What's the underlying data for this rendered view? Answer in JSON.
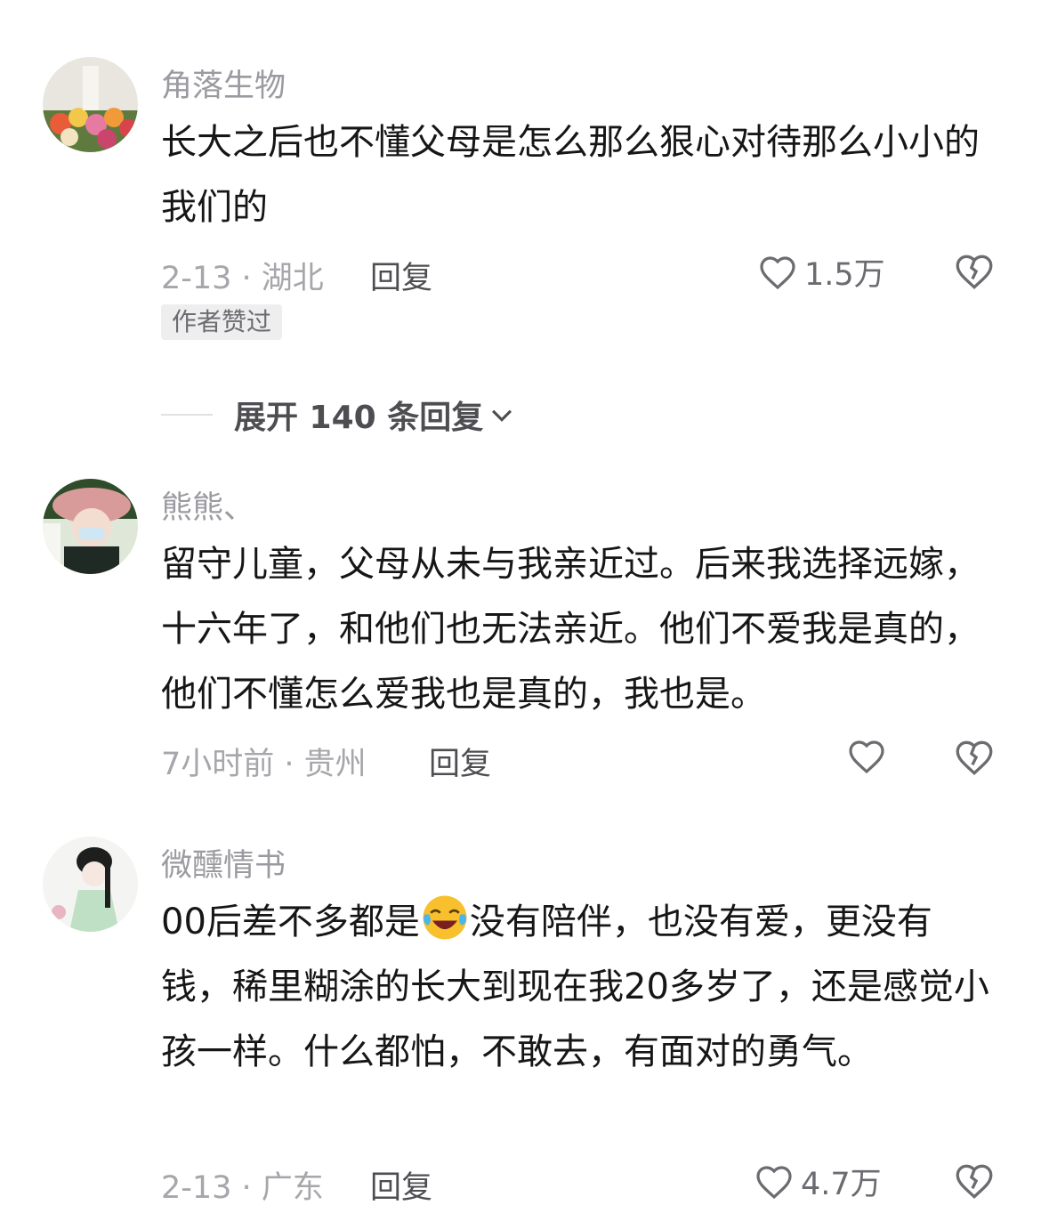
{
  "comments": [
    {
      "username": "角落生物",
      "text": "长大之后也不懂父母是怎么那么狠心对待那么小小的我们的",
      "meta": "2-13 · 湖北",
      "reply_label": "回复",
      "likes": "1.5万",
      "badge": "作者赞过"
    },
    {
      "username": "熊熊、",
      "text": "留守儿童，父母从未与我亲近过。后来我选择远嫁，十六年了，和他们也无法亲近。他们不爱我是真的，他们不懂怎么爱我也是真的，我也是。",
      "meta": "7小时前 · 贵州",
      "reply_label": "回复",
      "likes": ""
    },
    {
      "username": "微醺情书",
      "text_before_emoji": "00后差不多都是",
      "text_after_emoji": "没有陪伴，也没有爱，更没有钱，稀里糊涂的长大到现在我20多岁了，还是感觉小孩一样。什么都怕，不敢去，有面对的勇气。",
      "meta": "2-13 · 广东",
      "reply_label": "回复",
      "likes": "4.7万"
    }
  ],
  "expand_label": "展开 140 条回复",
  "icons": {
    "like": "heart-outline-icon",
    "dislike": "broken-heart-icon",
    "expand": "chevron-down-icon",
    "emoji": "laughing-crying-emoji"
  },
  "colors": {
    "text": "#161616",
    "muted": "#9a9aa0",
    "reply": "#4e4e52"
  }
}
